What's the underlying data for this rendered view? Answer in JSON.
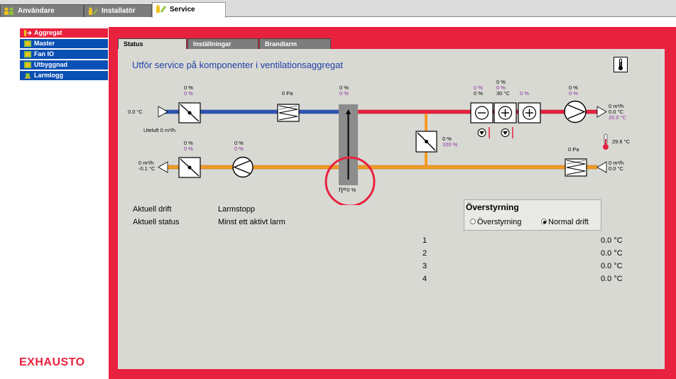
{
  "top_tabs": [
    {
      "label": "Användare",
      "active": false
    },
    {
      "label": "Installatör",
      "active": false
    },
    {
      "label": "Service",
      "active": true
    }
  ],
  "sidebar": {
    "items": [
      {
        "label": "Aggregat",
        "icon": "arrow-in-icon",
        "active": true
      },
      {
        "label": "Master",
        "icon": "device-icon",
        "active": false
      },
      {
        "label": "Fan IO",
        "icon": "device-icon",
        "active": false
      },
      {
        "label": "Utbyggnad",
        "icon": "device-icon",
        "active": false
      },
      {
        "label": "Larmlogg",
        "icon": "bell-icon",
        "active": false
      }
    ]
  },
  "brand": {
    "logo": "EXHAUSTO",
    "accent": "#e8213e",
    "nav_blue": "#0a4fb4"
  },
  "sub_tabs": [
    {
      "label": "Status",
      "active": true
    },
    {
      "label": "Inställningar",
      "active": false
    },
    {
      "label": "Brandlarm",
      "active": false
    }
  ],
  "panel": {
    "title": "Utför service på komponenter i ventilationsaggregat"
  },
  "diagram": {
    "outdoor_temp": "0.0 °C",
    "outdoor_flow": "Uteluft 0 m³/h",
    "damper_in": {
      "v1": "0 %",
      "v2": "0 %"
    },
    "filter_in_pressure": "0 Pa",
    "hx_top": {
      "v1": "0 %",
      "v2": "0 %"
    },
    "heater1": {
      "v1": "0 %",
      "v2": "0 %"
    },
    "heater2": {
      "v1": "0 %",
      "v2": "0 %",
      "v3": "0 %",
      "temp": "30 °C"
    },
    "heater3": "0 %",
    "supply_fan": {
      "v1": "0 %",
      "v2": "0 %"
    },
    "supply_out": {
      "flow": "0 m³/h",
      "temp": "0.0 °C",
      "setpoint": "20.0 °C"
    },
    "room_temp": "29.6 °C",
    "bypass": {
      "v1": "0 %",
      "v2": "100 %"
    },
    "filter_ex_pressure": "0 Pa",
    "extract_in": {
      "flow": "0 m³/h",
      "temp": "0.0 °C"
    },
    "exhaust_out": {
      "flow": "0 m³/h",
      "temp": "-0.1 °C"
    },
    "damper_ex": {
      "v1": "0 %",
      "v2": "0 %"
    },
    "exhaust_fan": {
      "v1": "0 %",
      "v2": "0 %"
    },
    "efficiency": "η=",
    "efficiency_value": "0 %"
  },
  "status": {
    "drift_label": "Aktuell drift",
    "drift_value": "Larmstopp",
    "status_label": "Aktuell status",
    "status_value": "Minst ett aktivt larm"
  },
  "override": {
    "title": "Överstyrning",
    "option1": "Överstyrning",
    "option2": "Normal drift",
    "selected": "Normal drift"
  },
  "temperatures": [
    {
      "index": "1",
      "value": "0.0 °C"
    },
    {
      "index": "2",
      "value": "0.0 °C"
    },
    {
      "index": "3",
      "value": "0.0 °C"
    },
    {
      "index": "4",
      "value": "0.0 °C"
    }
  ]
}
